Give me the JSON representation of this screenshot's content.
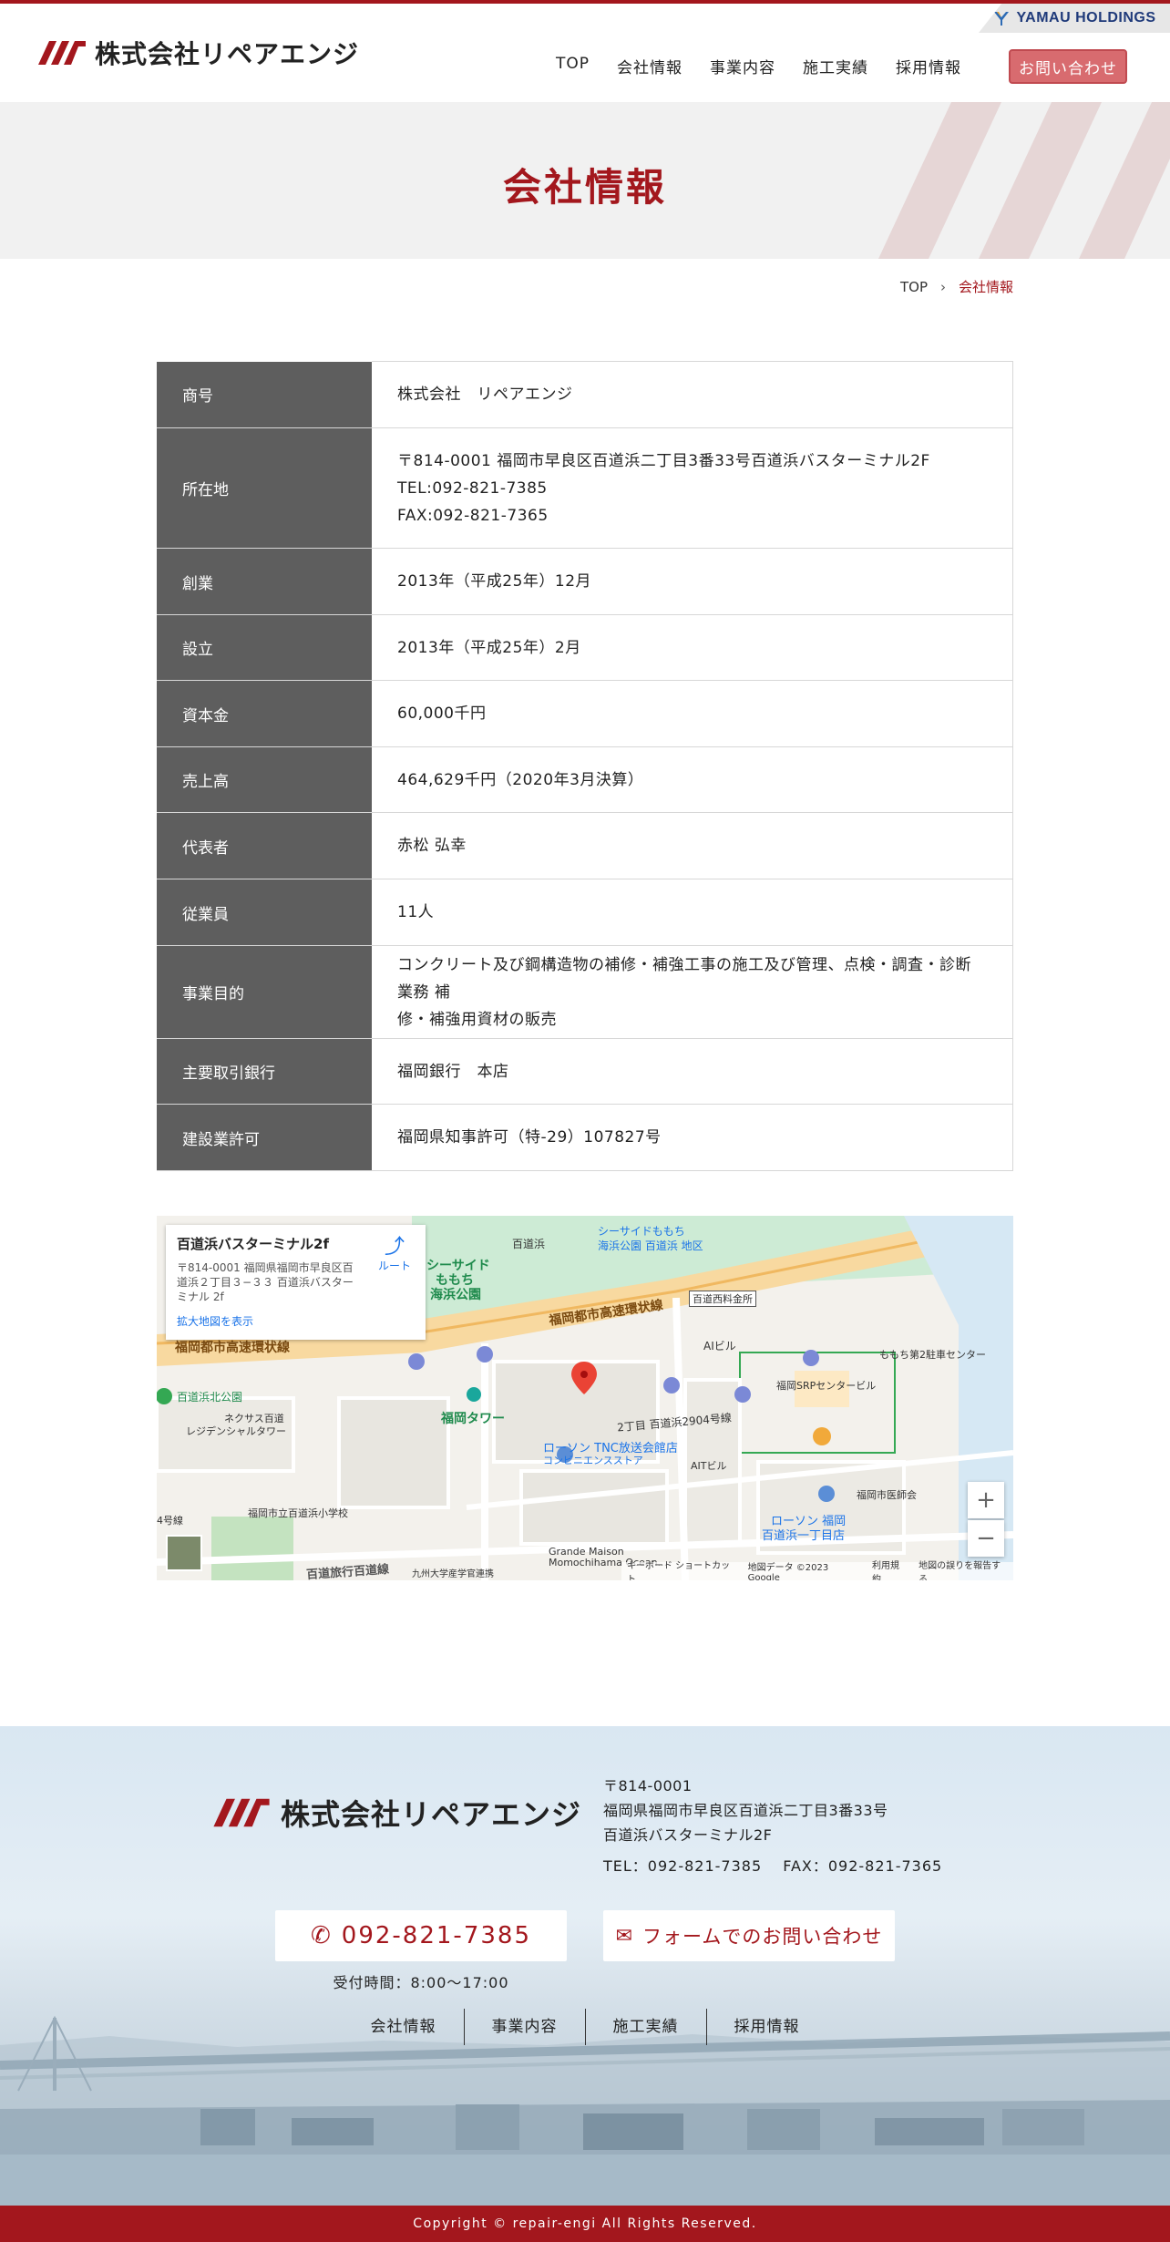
{
  "header": {
    "holdings_label": "YAMAU HOLDINGS",
    "company_name": "株式会社リペアエンジ",
    "nav": [
      {
        "label": "TOP"
      },
      {
        "label": "会社情報"
      },
      {
        "label": "事業内容"
      },
      {
        "label": "施工実績"
      },
      {
        "label": "採用情報"
      }
    ],
    "contact_label": "お問い合わせ"
  },
  "hero": {
    "title": "会社情報"
  },
  "breadcrumb": {
    "top": "TOP",
    "current": "会社情報"
  },
  "company_info": [
    {
      "label": "商号",
      "lines": [
        "株式会社　リペアエンジ"
      ]
    },
    {
      "label": "所在地",
      "lines": [
        "〒814-0001 福岡市早良区百道浜二丁目3番33号百道浜バスターミナル2F",
        "TEL:092-821-7385",
        "FAX:092-821-7365"
      ]
    },
    {
      "label": "創業",
      "lines": [
        "2013年（平成25年）12月"
      ]
    },
    {
      "label": "設立",
      "lines": [
        "2013年（平成25年）2月"
      ]
    },
    {
      "label": "資本金",
      "lines": [
        "60,000千円"
      ]
    },
    {
      "label": "売上高",
      "lines": [
        "464,629千円（2020年3月決算）"
      ]
    },
    {
      "label": "代表者",
      "lines": [
        "赤松 弘幸"
      ]
    },
    {
      "label": "従業員",
      "lines": [
        "11人"
      ]
    },
    {
      "label": "事業目的",
      "lines": [
        "コンクリート及び鋼構造物の補修・補強工事の施工及び管理、点検・調査・診断業務 補",
        "修・補強用資材の販売"
      ]
    },
    {
      "label": "主要取引銀行",
      "lines": [
        "福岡銀行　本店"
      ]
    },
    {
      "label": "建設業許可",
      "lines": [
        "福岡県知事許可（特-29）107827号"
      ]
    }
  ],
  "map": {
    "place_name": "百道浜バスターミナル2f",
    "place_address": "〒814-0001 福岡県福岡市早良区百道浜２丁目３−３３ 百道浜バスターミナル 2f",
    "enlarge_link": "拡大地図を表示",
    "route_label": "ルート",
    "zoom_in": "+",
    "zoom_out": "−",
    "footer_links": [
      "キーボード ショートカット",
      "地図データ ©2023 Google",
      "利用規約",
      "地図の誤りを報告する"
    ],
    "labels": [
      {
        "text": "百道浜",
        "style": ""
      },
      {
        "text": "シーサイドももち",
        "style": "blue"
      },
      {
        "text": "海浜公園 百道浜 地区",
        "style": "blue"
      },
      {
        "text": "シーサイド",
        "style": "green bold"
      },
      {
        "text": "ももち",
        "style": "green bold"
      },
      {
        "text": "海浜公園",
        "style": "green bold"
      },
      {
        "text": "福岡都市高速環状線",
        "style": "bold"
      },
      {
        "text": "百道西料金所",
        "style": ""
      },
      {
        "text": "福岡都市高速環状線",
        "style": "bold"
      },
      {
        "text": "AIビル",
        "style": ""
      },
      {
        "text": "ももち第2駐車センター",
        "style": ""
      },
      {
        "text": "福岡SRPセンタービル",
        "style": ""
      },
      {
        "text": "百道浜北公園",
        "style": "green"
      },
      {
        "text": "ネクサス百道",
        "style": ""
      },
      {
        "text": "レジデンシャルタワー",
        "style": ""
      },
      {
        "text": "福岡タワー",
        "style": "green bold"
      },
      {
        "text": "2丁目 百道浜2904号線",
        "style": ""
      },
      {
        "text": "ローソン TNC放送会館店",
        "style": "blue"
      },
      {
        "text": "コンビニエンスストア",
        "style": "blue"
      },
      {
        "text": "AITビル",
        "style": ""
      },
      {
        "text": "福岡市医師会",
        "style": ""
      },
      {
        "text": "ローソン 福岡",
        "style": "blue"
      },
      {
        "text": "百道浜一丁目店",
        "style": "blue"
      },
      {
        "text": "福岡市立百道浜小学校",
        "style": ""
      },
      {
        "text": "Grande Maison",
        "style": ""
      },
      {
        "text": "Momochihama Ocean...",
        "style": ""
      },
      {
        "text": "九州大学産学官連携",
        "style": ""
      },
      {
        "text": "百道旅行百道線",
        "style": "bold"
      },
      {
        "text": "4号線",
        "style": ""
      }
    ]
  },
  "footer": {
    "company_name": "株式会社リペアエンジ",
    "address_lines": [
      "〒814-0001",
      "福岡県福岡市早良区百道浜二丁目3番33号",
      "百道浜バスターミナル2F"
    ],
    "tel_fax": "TEL：092-821-7385　 FAX：092-821-7365",
    "tel_button": "092-821-7385",
    "form_button": "フォームでのお問い合わせ",
    "hours": "受付時間：8:00〜17:00",
    "nav": [
      {
        "label": "会社情報"
      },
      {
        "label": "事業内容"
      },
      {
        "label": "施工実績"
      },
      {
        "label": "採用情報"
      }
    ],
    "copyright": "Copyright © repair-engi All Rights Reserved."
  },
  "colors": {
    "brand_red": "#a3171d",
    "button_pink": "#d86b6f",
    "table_header": "#5e5e5e"
  }
}
